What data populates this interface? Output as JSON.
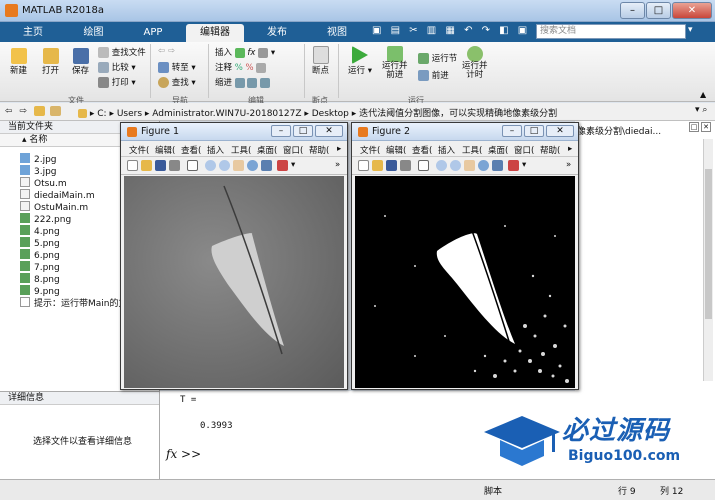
{
  "window": {
    "title": "MATLAB R2018a"
  },
  "tabs": [
    "主页",
    "绘图",
    "APP",
    "编辑器",
    "发布",
    "视图"
  ],
  "search": {
    "placeholder": "搜索文档"
  },
  "ribbon": {
    "file": {
      "new": "新建",
      "open": "打开",
      "save": "保存",
      "find_files": "查找文件",
      "compare": "比较",
      "print": "打印",
      "group": "文件"
    },
    "nav": {
      "goto": "转至",
      "find": "查找",
      "group": "导航"
    },
    "edit": {
      "insert": "插入",
      "comment": "注释",
      "indent": "缩进",
      "fx": "fx",
      "group": "编辑"
    },
    "breakpoint": {
      "label": "断点",
      "group": "断点"
    },
    "run": {
      "run": "运行",
      "run_advance": "运行并\n前进",
      "run_section": "运行节",
      "advance": "前进",
      "run_time": "运行并\n计时",
      "group": "运行"
    }
  },
  "address": {
    "segments": [
      "C:",
      "Users",
      "Administrator.WIN7U-20180127Z",
      "Desktop",
      "迭代法阈值分割图像，可以实现精确地像素级分割"
    ]
  },
  "current_folder": {
    "title": "当前文件夹",
    "column": "名称",
    "files": [
      "2.jpg",
      "3.jpg",
      "Otsu.m",
      "diedaiMain.m",
      "OstuMain.m",
      "222.png",
      "4.png",
      "5.png",
      "6.png",
      "7.png",
      "8.png",
      "9.png"
    ],
    "hint": "提示：运行带Main的文"
  },
  "detail": {
    "title": "详细信息",
    "message": "选择文件以查看详细信息"
  },
  "right_panel": {
    "path": "像素级分割\\diedai..."
  },
  "command": {
    "var": "T =",
    "value": "0.3993",
    "prompt": "fx >>"
  },
  "figure1": {
    "title": "Figure 1",
    "menu": [
      "文件(",
      "编辑(",
      "查看(",
      "插入",
      "工具(",
      "桌面(",
      "窗口(",
      "帮助("
    ]
  },
  "figure2": {
    "title": "Figure 2",
    "menu": [
      "文件(",
      "编辑(",
      "查看(",
      "插入",
      "工具(",
      "桌面(",
      "窗口(",
      "帮助("
    ]
  },
  "status": {
    "script": "脚本",
    "row_label": "行",
    "row": "9",
    "col_label": "列",
    "col": "12"
  },
  "watermark": {
    "cn": "必过源码",
    "url": "Biguo100.com"
  }
}
